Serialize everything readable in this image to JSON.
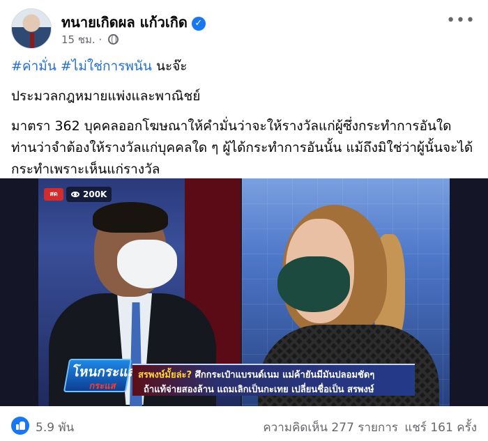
{
  "post": {
    "author": "ทนายเกิดผล แก้วเกิด",
    "time": "15 ชม.",
    "separator": "·",
    "more_label": "•••",
    "verified_glyph": "✓",
    "hashtags": [
      "#ค่ามั่น",
      "#ไม่ใช่การพนัน"
    ],
    "hashtag_suffix": "นะจ๊ะ",
    "paragraph1": "ประมวลกฎหมายแพ่งและพาณิชย์",
    "paragraph2": "มาตรา 362 บุคคลออกโฆษณาให้คำมั่นว่าจะให้รางวัลแก่ผู้ซึ่งกระทำการอันใด ท่านว่าจำต้องให้รางวัลแก่บุคคลใด ๆ ผู้ได้กระทำการอันนั้น แม้ถึงมิใช่ว่าผู้นั้นจะได้กระทำเพราะเห็นแก่รางวัล"
  },
  "video": {
    "live_badge": "สด",
    "views": "200K",
    "show_logo_line1": "โหนกระแส",
    "show_logo_line2": "กระแส",
    "ticker_highlight": "สรพงษ์มั้ยล่ะ?",
    "ticker_line1_rest": "ศึกกระเป๋าแบรนด์เนม แม่ค้ายันมีมันปลอมชัดๆ",
    "ticker_line2": "ถ้าแท้จ่ายสองล้าน แถมเลิกเป็นกะเทย เปลี่ยนชื่อเป็น สรพงษ์"
  },
  "footer": {
    "reactions": "5.9 พัน",
    "comments": "ความคิดเห็น 277 รายการ",
    "shares": "แชร์ 161 ครั้ง"
  },
  "colors": {
    "hashtag": "#216fdb",
    "verified": "#1877f2",
    "secondary_text": "#65676b"
  }
}
